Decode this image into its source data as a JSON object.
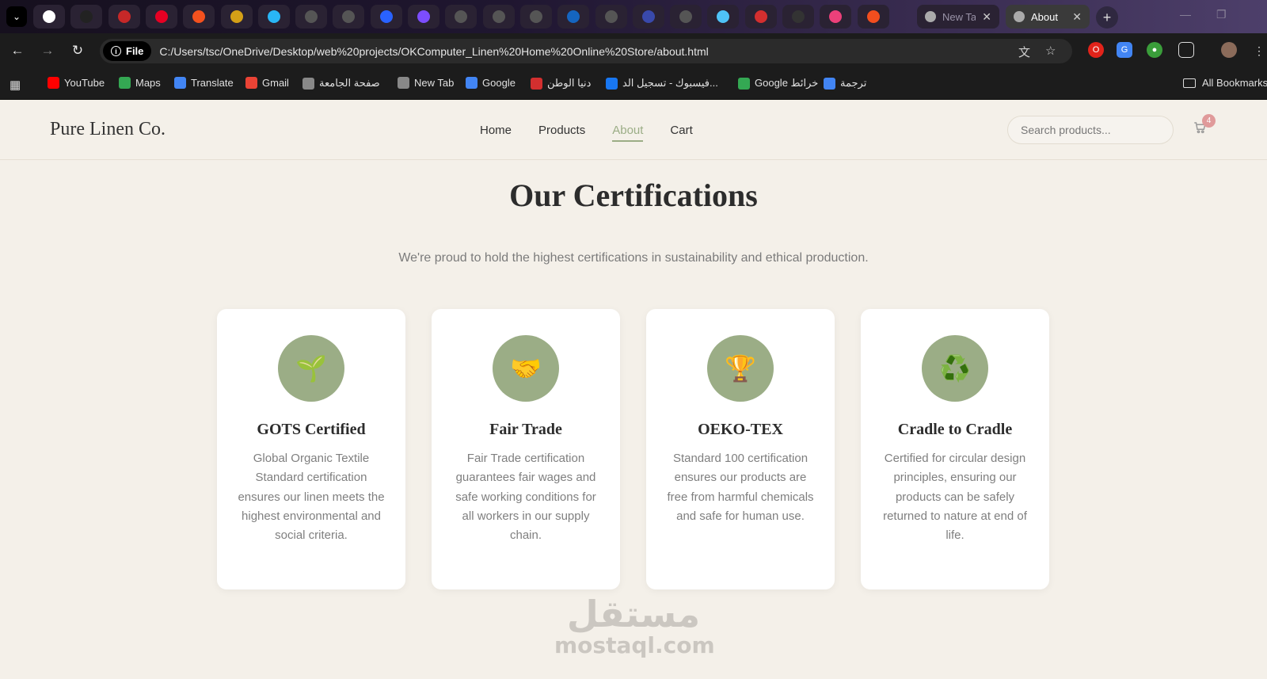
{
  "browser": {
    "tabs": {
      "pinned_icons": [
        "google-icon",
        "openai-icon",
        "gauge-icon",
        "pinterest-icon",
        "fire-icon",
        "shield-icon",
        "ring-icon",
        "globe-icon",
        "globe-icon",
        "diamond-icon",
        "sparkle-icon",
        "globe-icon",
        "globe-icon",
        "globe-icon",
        "moon-icon",
        "globe-icon",
        "bracket-icon",
        "globe-icon",
        "bowl-icon",
        "top-icon",
        "gear-icon",
        "heart-icon",
        "figma-icon"
      ],
      "new_tab_label": "New Ta",
      "active_tab_label": "About",
      "new_tab_button": "+"
    },
    "address": {
      "scheme_label": "File",
      "url": "C:/Users/tsc/OneDrive/Desktop/web%20projects/OKComputer_Linen%20Home%20Online%20Store/about.html"
    },
    "bookmarks": [
      {
        "label": "YouTube",
        "icon": "youtube-icon",
        "color": "#ff0000"
      },
      {
        "label": "Maps",
        "icon": "maps-icon",
        "color": "#34a853"
      },
      {
        "label": "Translate",
        "icon": "translate-icon",
        "color": "#4285f4"
      },
      {
        "label": "Gmail",
        "icon": "gmail-icon",
        "color": "#ea4335"
      },
      {
        "label": "صفحة الجامعة",
        "icon": "university-icon",
        "color": "#888888"
      },
      {
        "label": "New Tab",
        "icon": "globe-icon",
        "color": "#888888"
      },
      {
        "label": "Google",
        "icon": "google-icon",
        "color": "#4285f4"
      },
      {
        "label": "دنيا الوطن",
        "icon": "news-icon",
        "color": "#d32f2f"
      },
      {
        "label": "فيسبوك - تسجيل الد...",
        "icon": "facebook-icon",
        "color": "#1877f2"
      },
      {
        "label": "Google خرائط",
        "icon": "maps-icon",
        "color": "#34a853"
      },
      {
        "label": "ترجمة",
        "icon": "translate-icon",
        "color": "#4285f4"
      }
    ],
    "all_bookmarks_label": "All Bookmarks"
  },
  "site": {
    "logo": "Pure Linen Co.",
    "nav": [
      "Home",
      "Products",
      "About",
      "Cart"
    ],
    "active_nav": "About",
    "search_placeholder": "Search products...",
    "cart_count": "4"
  },
  "certifications": {
    "title": "Our Certifications",
    "subtitle": "We're proud to hold the highest certifications in sustainability and ethical production.",
    "accent_color": "#9bad86",
    "items": [
      {
        "icon": "seedling-icon",
        "glyph": "🌱",
        "name": "GOTS Certified",
        "description": "Global Organic Textile Standard certification ensures our linen meets the highest environmental and social criteria."
      },
      {
        "icon": "handshake-icon",
        "glyph": "🤝",
        "name": "Fair Trade",
        "description": "Fair Trade certification guarantees fair wages and safe working conditions for all workers in our supply chain."
      },
      {
        "icon": "trophy-icon",
        "glyph": "🏆",
        "name": "OEKO-TEX",
        "description": "Standard 100 certification ensures our products are free from harmful chemicals and safe for human use."
      },
      {
        "icon": "recycle-icon",
        "glyph": "♻️",
        "name": "Cradle to Cradle",
        "description": "Certified for circular design principles, ensuring our products can be safely returned to nature at end of life."
      }
    ]
  },
  "watermark": {
    "arabic": "مستقل",
    "latin": "mostaql.com"
  }
}
